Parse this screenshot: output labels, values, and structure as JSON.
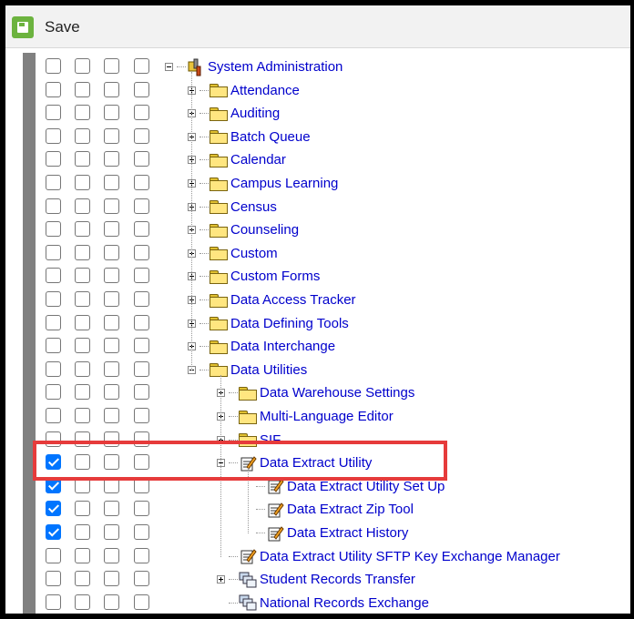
{
  "toolbar": {
    "save_label": "Save"
  },
  "tree": {
    "root": "System Administration",
    "folders": [
      "Attendance",
      "Auditing",
      "Batch Queue",
      "Calendar",
      "Campus Learning",
      "Census",
      "Counseling",
      "Custom",
      "Custom Forms",
      "Data Access Tracker",
      "Data Defining Tools",
      "Data Interchange"
    ],
    "data_utilities": {
      "label": "Data Utilities",
      "children": [
        "Data Warehouse Settings",
        "Multi-Language Editor",
        "SIF"
      ],
      "extract": {
        "label": "Data Extract Utility",
        "children": [
          "Data Extract Utility Set Up",
          "Data Extract Zip Tool",
          "Data Extract History"
        ]
      },
      "after": [
        "Data Extract Utility SFTP Key Exchange Manager",
        "Student Records Transfer",
        "National Records Exchange"
      ]
    }
  },
  "checked_rows": [
    17,
    18,
    19,
    20
  ]
}
